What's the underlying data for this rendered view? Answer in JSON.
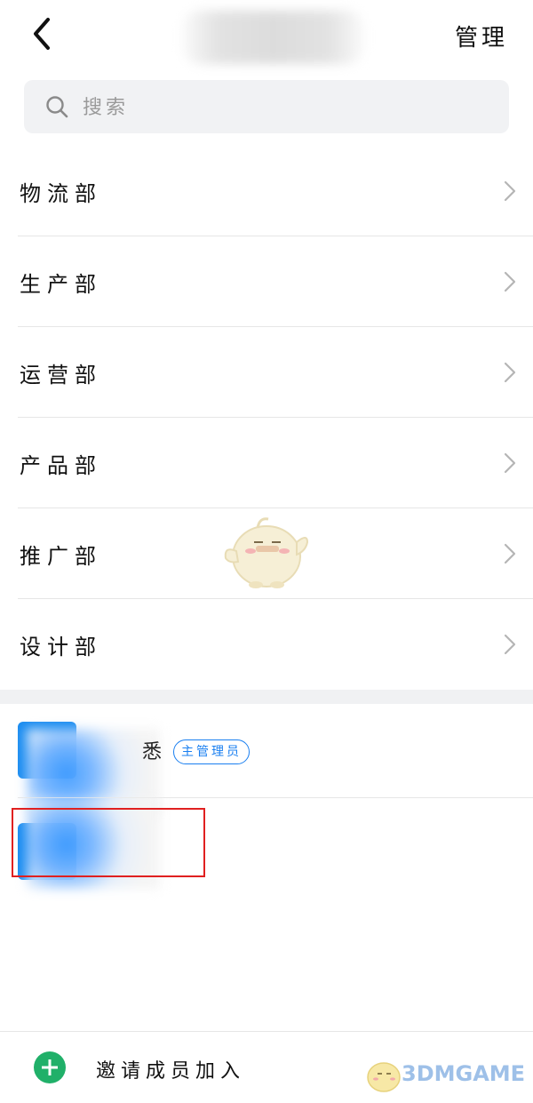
{
  "header": {
    "back_icon": "chevron-left-icon",
    "manage_label": "管理"
  },
  "search": {
    "placeholder": "搜索",
    "icon": "search-icon"
  },
  "departments": [
    {
      "label": "物流部"
    },
    {
      "label": "生产部"
    },
    {
      "label": "运营部"
    },
    {
      "label": "产品部"
    },
    {
      "label": "推广部"
    },
    {
      "label": "设计部"
    }
  ],
  "members": [
    {
      "name_visible_suffix": "悉",
      "badge": "主管理员"
    },
    {
      "name_visible_suffix": "",
      "badge": ""
    }
  ],
  "bottom": {
    "invite_label": "邀请成员加入",
    "plus_icon": "plus-icon"
  },
  "watermark": {
    "text": "3DMGAME"
  },
  "colors": {
    "accent_blue": "#1a7ff0",
    "avatar_blue": "#1a8cf0",
    "invite_green": "#20b069",
    "highlight_red": "#e02020",
    "search_bg": "#f1f2f4"
  }
}
